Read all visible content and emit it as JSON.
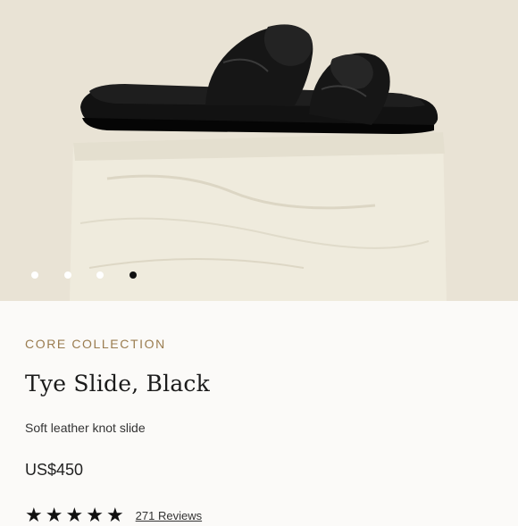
{
  "product_image": {
    "alt_icon": "product-photo",
    "carousel_total": 4,
    "carousel_active_index": 4
  },
  "product": {
    "collection": "CORE COLLECTION",
    "name": "Tye Slide, Black",
    "description": "Soft leather knot slide",
    "price": "US$450"
  },
  "rating": {
    "stars": 5,
    "max_stars": 5,
    "reviews_label": "271 Reviews"
  },
  "colors": {
    "accent": "#9a7c4f",
    "background": "#fbfaf8",
    "hero_background": "#e8e2d4"
  }
}
